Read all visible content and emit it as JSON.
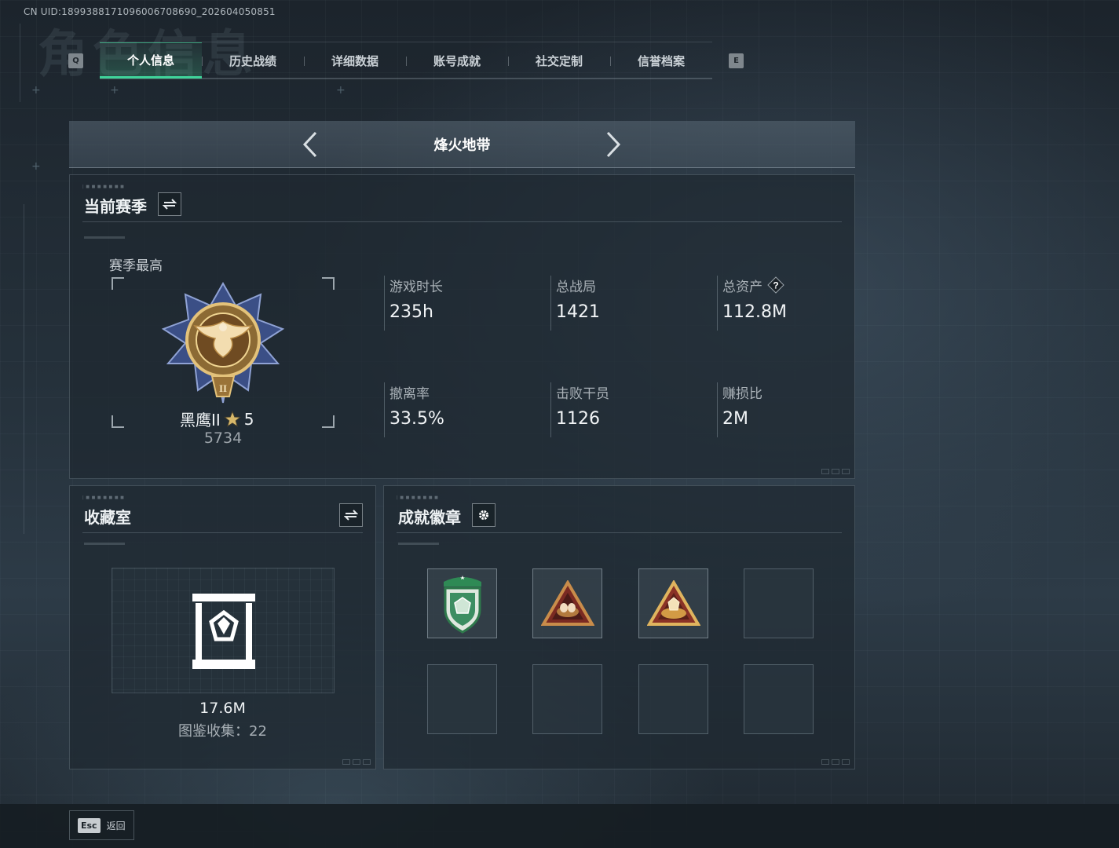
{
  "uid_text": "CN UID:1899388171096006708690_202604050851",
  "background_title": "角色信息",
  "keys": {
    "prev_tab": "Q",
    "next_tab": "E"
  },
  "tabs": [
    {
      "label": "个人信息",
      "active": true
    },
    {
      "label": "历史战绩",
      "active": false
    },
    {
      "label": "详细数据",
      "active": false
    },
    {
      "label": "账号成就",
      "active": false
    },
    {
      "label": "社交定制",
      "active": false
    },
    {
      "label": "信誉档案",
      "active": false
    }
  ],
  "mode": {
    "title": "烽火地带"
  },
  "season": {
    "title": "当前赛季",
    "best_label": "赛季最高",
    "rank_name": "黑鹰II",
    "rank_stars": "5",
    "rank_score": "5734",
    "stats": [
      {
        "label": "游戏时长",
        "value": "235h"
      },
      {
        "label": "总战局",
        "value": "1421"
      },
      {
        "label": "总资产",
        "value": "112.8M",
        "help": "?"
      },
      {
        "label": "撤离率",
        "value": "33.5%"
      },
      {
        "label": "击败干员",
        "value": "1126"
      },
      {
        "label": "赚损比",
        "value": "2M"
      }
    ]
  },
  "collection": {
    "title": "收藏室",
    "value": "17.6M",
    "count_text": "图鉴收集：22"
  },
  "badges": {
    "title": "成就徽章",
    "slots": [
      "shield-badge",
      "nest-badge-bronze",
      "nest-badge-gold",
      "",
      "",
      "",
      "",
      ""
    ]
  },
  "footer": {
    "esc_key": "Esc",
    "esc_label": "返回"
  },
  "colors": {
    "accent": "#3fd39a",
    "background": "#25313b",
    "panel": "#1e2831"
  }
}
